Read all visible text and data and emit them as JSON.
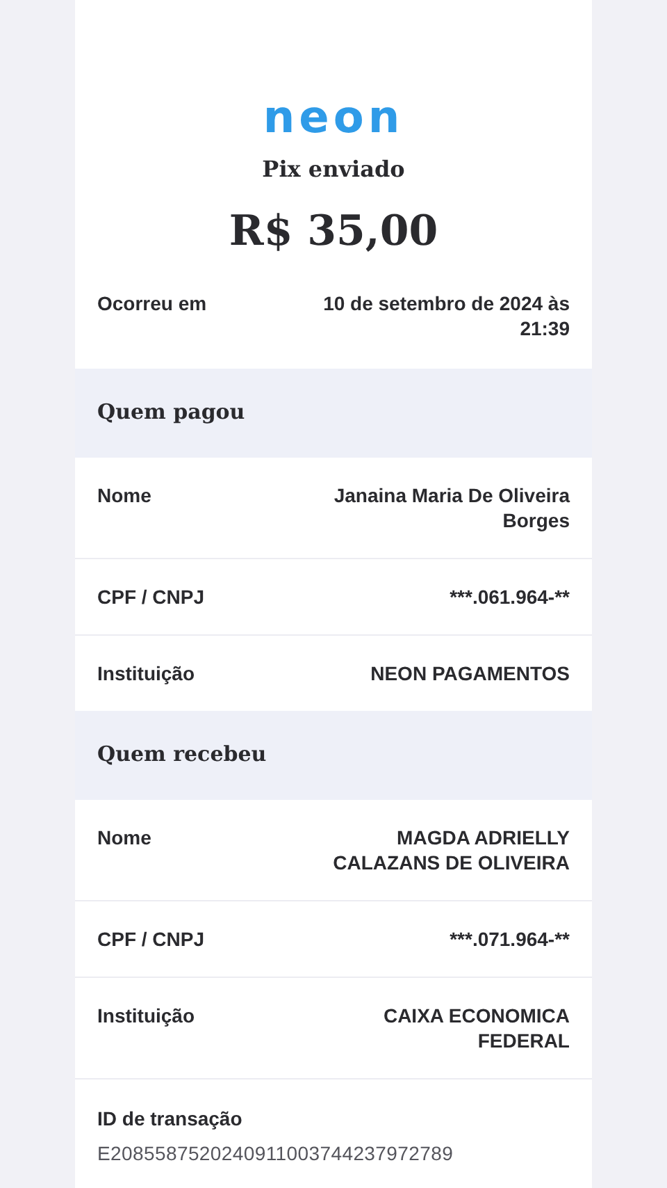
{
  "logo": "neon",
  "title": "Pix enviado",
  "amount": "R$ 35,00",
  "occurred": {
    "label": "Ocorreu em",
    "value": "10 de setembro de 2024 às 21:39"
  },
  "sections": [
    {
      "title": "Quem pagou",
      "rows": [
        {
          "label": "Nome",
          "value": "Janaina Maria De Oliveira Borges"
        },
        {
          "label": "CPF / CNPJ",
          "value": "***.061.964-**"
        },
        {
          "label": "Instituição",
          "value": "NEON PAGAMENTOS"
        }
      ]
    },
    {
      "title": "Quem recebeu",
      "rows": [
        {
          "label": "Nome",
          "value": "MAGDA ADRIELLY CALAZANS DE OLIVEIRA"
        },
        {
          "label": "CPF / CNPJ",
          "value": "***.071.964-**"
        },
        {
          "label": "Instituição",
          "value": "CAIXA ECONOMICA FEDERAL"
        }
      ]
    }
  ],
  "transaction_id": {
    "label": "ID de transação",
    "value": "E2085587520240911003744237972789"
  }
}
